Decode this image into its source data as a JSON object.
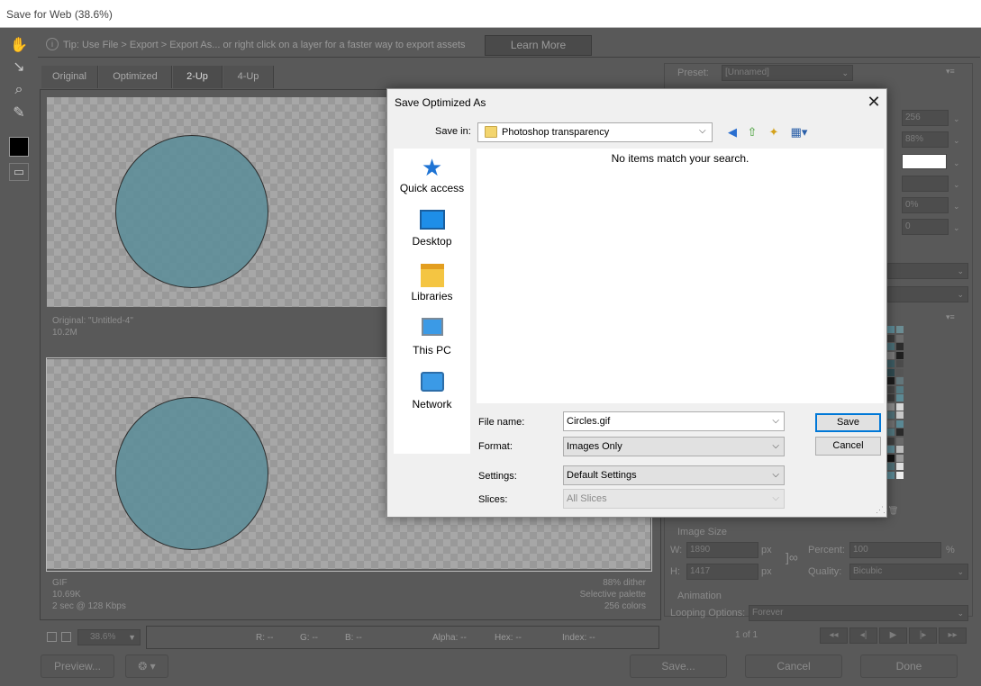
{
  "window": {
    "title": "Save for Web (38.6%)"
  },
  "tip": {
    "text": "Tip: Use File > Export > Export As...  or right click on a layer for a faster way to export assets",
    "learn_more": "Learn More"
  },
  "tabs": [
    "Original",
    "Optimized",
    "2-Up",
    "4-Up"
  ],
  "active_tab": "2-Up",
  "original_pane": {
    "name": "Original: \"Untitled-4\"",
    "size": "10.2M"
  },
  "optimized_pane": {
    "format": "GIF",
    "size": "10.69K",
    "time": "2 sec @ 128 Kbps",
    "dither": "88% dither",
    "palette": "Selective palette",
    "colors": "256 colors"
  },
  "status": {
    "zoom": "38.6%",
    "r": "R: --",
    "g": "G: --",
    "b": "B: --",
    "alpha": "Alpha: --",
    "hex": "Hex: --",
    "index": "Index: --"
  },
  "bottom_buttons": {
    "preview": "Preview...",
    "save": "Save...",
    "cancel": "Cancel",
    "done": "Done"
  },
  "right_panel": {
    "preset_label": "Preset:",
    "preset_value": "[Unnamed]",
    "fields": [
      "256",
      "88%",
      "",
      "",
      "0%",
      "0"
    ],
    "image_size_title": "Image Size",
    "w_label": "W:",
    "w_value": "1890",
    "h_label": "H:",
    "h_value": "1417",
    "px": "px",
    "percent_label": "Percent:",
    "percent_value": "100",
    "percent_unit": "%",
    "quality_label": "Quality:",
    "quality_value": "Bicubic",
    "animation_title": "Animation",
    "looping_label": "Looping Options:",
    "looping_value": "Forever",
    "frame_counter": "1 of 1"
  },
  "dialog": {
    "title": "Save Optimized As",
    "save_in_label": "Save in:",
    "save_in_value": "Photoshop transparency",
    "empty_message": "No items match your search.",
    "places": [
      "Quick access",
      "Desktop",
      "Libraries",
      "This PC",
      "Network"
    ],
    "file_name_label": "File name:",
    "file_name_value": "Circles.gif",
    "format_label": "Format:",
    "format_value": "Images Only",
    "settings_label": "Settings:",
    "settings_value": "Default Settings",
    "slices_label": "Slices:",
    "slices_value": "All Slices",
    "save_button": "Save",
    "cancel_button": "Cancel"
  },
  "colors": {
    "circle": "#5f8f9a",
    "accent": "#0078d7",
    "folder": "#f3d56e"
  }
}
